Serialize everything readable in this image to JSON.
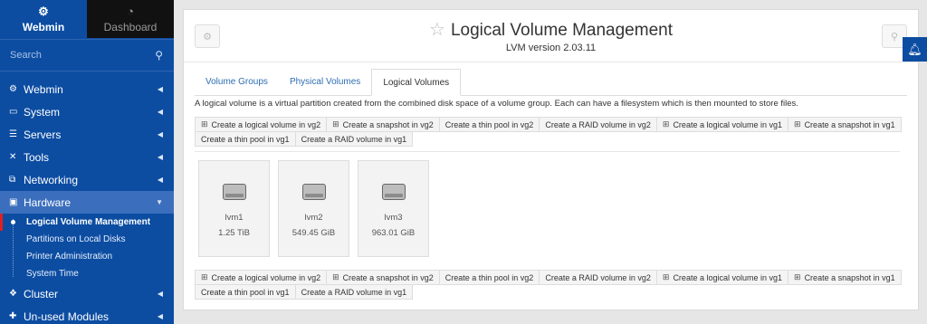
{
  "brand": {
    "webmin": "Webmin",
    "dashboard": "Dashboard"
  },
  "search": {
    "placeholder": "Search"
  },
  "menu": [
    {
      "label": "Webmin",
      "icon": "gear-icon"
    },
    {
      "label": "System",
      "icon": "monitor-icon"
    },
    {
      "label": "Servers",
      "icon": "servers-icon"
    },
    {
      "label": "Tools",
      "icon": "wrench-icon"
    },
    {
      "label": "Networking",
      "icon": "network-icon"
    },
    {
      "label": "Hardware",
      "icon": "harddrive-icon"
    },
    {
      "label": "Cluster",
      "icon": "cluster-icon"
    },
    {
      "label": "Un-used Modules",
      "icon": "puzzle-icon"
    }
  ],
  "hardware_sub": [
    "Logical Volume Management",
    "Partitions on Local Disks",
    "Printer Administration",
    "System Time"
  ],
  "page": {
    "title": "Logical Volume Management",
    "subtitle": "LVM version 2.03.11"
  },
  "tabs": [
    "Volume Groups",
    "Physical Volumes",
    "Logical Volumes"
  ],
  "description": "A logical volume is a virtual partition created from the combined disk space of a volume group. Each can have a filesystem which is then mounted to store files.",
  "actions": [
    {
      "label": "Create a logical volume in vg2",
      "icon": true
    },
    {
      "label": "Create a snapshot in vg2",
      "icon": true
    },
    {
      "label": "Create a thin pool in vg2",
      "icon": false
    },
    {
      "label": "Create a RAID volume in vg2",
      "icon": false
    },
    {
      "label": "Create a logical volume in vg1",
      "icon": true
    },
    {
      "label": "Create a snapshot in vg1",
      "icon": true
    },
    {
      "label": "Create a thin pool in vg1",
      "icon": false
    },
    {
      "label": "Create a RAID volume in vg1",
      "icon": false
    }
  ],
  "volumes": [
    {
      "name": "lvm1",
      "size": "1.25 TiB"
    },
    {
      "name": "lvm2",
      "size": "549.45 GiB"
    },
    {
      "name": "lvm3",
      "size": "963.01 GiB"
    }
  ],
  "colors": {
    "sidebar": "#0c4da2",
    "active_menu": "#3b6fbd",
    "current_marker": "#e02020",
    "link": "#2f6eb3"
  }
}
